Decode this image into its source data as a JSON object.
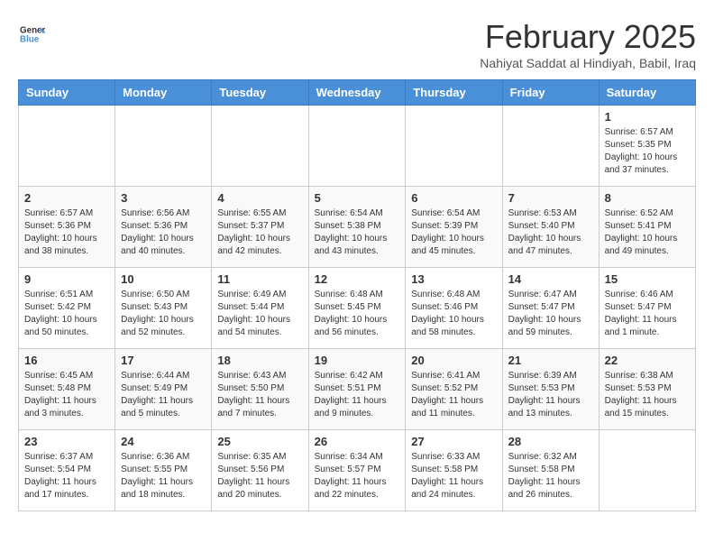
{
  "header": {
    "logo_line1": "General",
    "logo_line2": "Blue",
    "title": "February 2025",
    "subtitle": "Nahiyat Saddat al Hindiyah, Babil, Iraq"
  },
  "weekdays": [
    "Sunday",
    "Monday",
    "Tuesday",
    "Wednesday",
    "Thursday",
    "Friday",
    "Saturday"
  ],
  "weeks": [
    [
      {
        "day": "",
        "info": ""
      },
      {
        "day": "",
        "info": ""
      },
      {
        "day": "",
        "info": ""
      },
      {
        "day": "",
        "info": ""
      },
      {
        "day": "",
        "info": ""
      },
      {
        "day": "",
        "info": ""
      },
      {
        "day": "1",
        "info": "Sunrise: 6:57 AM\nSunset: 5:35 PM\nDaylight: 10 hours\nand 37 minutes."
      }
    ],
    [
      {
        "day": "2",
        "info": "Sunrise: 6:57 AM\nSunset: 5:36 PM\nDaylight: 10 hours\nand 38 minutes."
      },
      {
        "day": "3",
        "info": "Sunrise: 6:56 AM\nSunset: 5:36 PM\nDaylight: 10 hours\nand 40 minutes."
      },
      {
        "day": "4",
        "info": "Sunrise: 6:55 AM\nSunset: 5:37 PM\nDaylight: 10 hours\nand 42 minutes."
      },
      {
        "day": "5",
        "info": "Sunrise: 6:54 AM\nSunset: 5:38 PM\nDaylight: 10 hours\nand 43 minutes."
      },
      {
        "day": "6",
        "info": "Sunrise: 6:54 AM\nSunset: 5:39 PM\nDaylight: 10 hours\nand 45 minutes."
      },
      {
        "day": "7",
        "info": "Sunrise: 6:53 AM\nSunset: 5:40 PM\nDaylight: 10 hours\nand 47 minutes."
      },
      {
        "day": "8",
        "info": "Sunrise: 6:52 AM\nSunset: 5:41 PM\nDaylight: 10 hours\nand 49 minutes."
      }
    ],
    [
      {
        "day": "9",
        "info": "Sunrise: 6:51 AM\nSunset: 5:42 PM\nDaylight: 10 hours\nand 50 minutes."
      },
      {
        "day": "10",
        "info": "Sunrise: 6:50 AM\nSunset: 5:43 PM\nDaylight: 10 hours\nand 52 minutes."
      },
      {
        "day": "11",
        "info": "Sunrise: 6:49 AM\nSunset: 5:44 PM\nDaylight: 10 hours\nand 54 minutes."
      },
      {
        "day": "12",
        "info": "Sunrise: 6:48 AM\nSunset: 5:45 PM\nDaylight: 10 hours\nand 56 minutes."
      },
      {
        "day": "13",
        "info": "Sunrise: 6:48 AM\nSunset: 5:46 PM\nDaylight: 10 hours\nand 58 minutes."
      },
      {
        "day": "14",
        "info": "Sunrise: 6:47 AM\nSunset: 5:47 PM\nDaylight: 10 hours\nand 59 minutes."
      },
      {
        "day": "15",
        "info": "Sunrise: 6:46 AM\nSunset: 5:47 PM\nDaylight: 11 hours\nand 1 minute."
      }
    ],
    [
      {
        "day": "16",
        "info": "Sunrise: 6:45 AM\nSunset: 5:48 PM\nDaylight: 11 hours\nand 3 minutes."
      },
      {
        "day": "17",
        "info": "Sunrise: 6:44 AM\nSunset: 5:49 PM\nDaylight: 11 hours\nand 5 minutes."
      },
      {
        "day": "18",
        "info": "Sunrise: 6:43 AM\nSunset: 5:50 PM\nDaylight: 11 hours\nand 7 minutes."
      },
      {
        "day": "19",
        "info": "Sunrise: 6:42 AM\nSunset: 5:51 PM\nDaylight: 11 hours\nand 9 minutes."
      },
      {
        "day": "20",
        "info": "Sunrise: 6:41 AM\nSunset: 5:52 PM\nDaylight: 11 hours\nand 11 minutes."
      },
      {
        "day": "21",
        "info": "Sunrise: 6:39 AM\nSunset: 5:53 PM\nDaylight: 11 hours\nand 13 minutes."
      },
      {
        "day": "22",
        "info": "Sunrise: 6:38 AM\nSunset: 5:53 PM\nDaylight: 11 hours\nand 15 minutes."
      }
    ],
    [
      {
        "day": "23",
        "info": "Sunrise: 6:37 AM\nSunset: 5:54 PM\nDaylight: 11 hours\nand 17 minutes."
      },
      {
        "day": "24",
        "info": "Sunrise: 6:36 AM\nSunset: 5:55 PM\nDaylight: 11 hours\nand 18 minutes."
      },
      {
        "day": "25",
        "info": "Sunrise: 6:35 AM\nSunset: 5:56 PM\nDaylight: 11 hours\nand 20 minutes."
      },
      {
        "day": "26",
        "info": "Sunrise: 6:34 AM\nSunset: 5:57 PM\nDaylight: 11 hours\nand 22 minutes."
      },
      {
        "day": "27",
        "info": "Sunrise: 6:33 AM\nSunset: 5:58 PM\nDaylight: 11 hours\nand 24 minutes."
      },
      {
        "day": "28",
        "info": "Sunrise: 6:32 AM\nSunset: 5:58 PM\nDaylight: 11 hours\nand 26 minutes."
      },
      {
        "day": "",
        "info": ""
      }
    ]
  ]
}
